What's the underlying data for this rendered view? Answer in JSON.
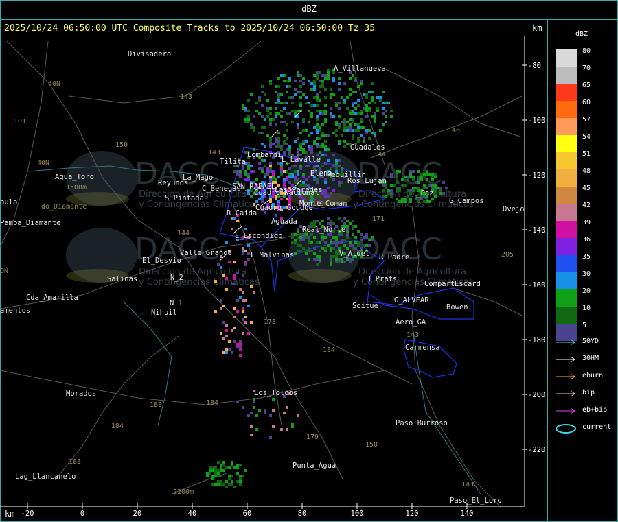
{
  "title": "dBZ",
  "header": "2025/10/24 06:50:00 UTC Composite Tracks to 2025/10/24 06:50:00 Tz 35",
  "km_label": "km",
  "legend": {
    "title": "dBZ",
    "entries": [
      {
        "label": "80",
        "color": "#d9d9d9"
      },
      {
        "label": "70",
        "color": "#bdbdbd"
      },
      {
        "label": "65",
        "color": "#ff3a1a"
      },
      {
        "label": "60",
        "color": "#ff6a10"
      },
      {
        "label": "57",
        "color": "#ff9a5a"
      },
      {
        "label": "54",
        "color": "#ffff10"
      },
      {
        "label": "51",
        "color": "#f8c830"
      },
      {
        "label": "48",
        "color": "#f0b040"
      },
      {
        "label": "45",
        "color": "#d08840"
      },
      {
        "label": "42",
        "color": "#c87890"
      },
      {
        "label": "39",
        "color": "#d010a0"
      },
      {
        "label": "36",
        "color": "#8020e0"
      },
      {
        "label": "35",
        "color": "#2050f0"
      },
      {
        "label": "30",
        "color": "#1890e8"
      },
      {
        "label": "20",
        "color": "#10a018"
      },
      {
        "label": "10",
        "color": "#106810"
      },
      {
        "label": "5",
        "color": "#4a4490"
      }
    ],
    "tracks": [
      {
        "label": "50YD",
        "color": "#30d8e8"
      },
      {
        "label": "30HM",
        "color": "#ffffff"
      },
      {
        "label": "eburn",
        "color": "#ffb030"
      },
      {
        "label": "bip",
        "color": "#ffc0d0"
      },
      {
        "label": "eb+bip",
        "color": "#e040e0"
      },
      {
        "label": "current",
        "color": "#30e0f0"
      }
    ]
  },
  "y_axis": [
    "-80",
    "-100",
    "-120",
    "-140",
    "-160",
    "-180",
    "-200",
    "-220"
  ],
  "x_axis": [
    "-20",
    "0",
    "20",
    "40",
    "60",
    "80",
    "100",
    "120",
    "140"
  ],
  "places": [
    "Divisadero",
    "A_Villanueva",
    "Guadales",
    "Tilita",
    "Lombardi",
    "L_Lavalle",
    "Elena",
    "Pequillin",
    "Ros_Lujan",
    "L_Paz",
    "G_Campos",
    "Ovejo",
    "Agua_Toro",
    "Reyunos",
    "La_Mago",
    "S_Pintada",
    "C_Benegas",
    "SAN_RAFAEL",
    "Las_Paredes",
    "Goudge",
    "Cuadro",
    "R_Caida",
    "Aguada",
    "Monte_Coman",
    "Cuadro_Nacional",
    "E_Escondido",
    "L_Malvinas",
    "Real_Norte",
    "V_Atuel",
    "R_Padre",
    "J_Prats",
    "Compart",
    "Escard",
    "Soitue",
    "G_ALVEAR",
    "Bowen",
    "Aero_GA",
    "Carmensa",
    "Valle_Grande",
    "El_Desvio",
    "Salinas",
    "Nihuil",
    "N_1",
    "N_2",
    "Pampa_Diamante",
    "Cda_Amarilla",
    "amentos",
    "Morados",
    "Los_Toldos",
    "Paso_Burroso",
    "Punta_Agua",
    "Lag_Llancanelo",
    "Paso_El_Loro",
    "aula",
    "do_Diamante",
    "1500m",
    "2200m"
  ],
  "road_numbers": [
    "40N",
    "40N",
    "101",
    "143",
    "150",
    "143",
    "144",
    "144",
    "173",
    "180",
    "184",
    "184",
    "184",
    "183",
    "179",
    "150",
    "171",
    "146",
    "143",
    "179",
    "205",
    "ON"
  ],
  "watermark": {
    "logo": "DACC",
    "line1": "Direccion de Agricultura",
    "line2": "y Contingencias Climaticas",
    "url": "www.contingencias.mendoza.gov.ar"
  }
}
